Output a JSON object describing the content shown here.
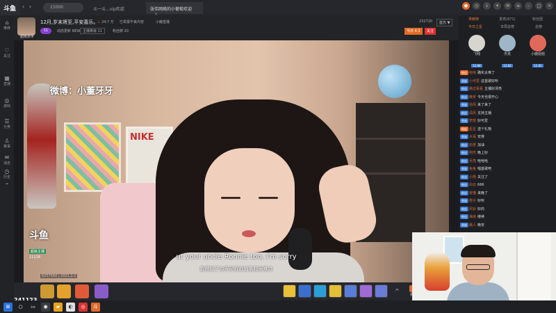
{
  "app": {
    "logo": "斗鱼"
  },
  "search": {
    "value": "15000"
  },
  "tabs": [
    {
      "label": "斗一斗...vip欢迎",
      "active": false
    },
    {
      "label": "张伟网络的小葡萄欢迎",
      "active": true
    }
  ],
  "sidebar": [
    {
      "icon": "⌂",
      "label": "推荐"
    },
    {
      "icon": "♡",
      "label": "关注"
    },
    {
      "icon": "▦",
      "label": "直播"
    },
    {
      "icon": "◎",
      "label": "游戏"
    },
    {
      "icon": "☰",
      "label": "分类"
    },
    {
      "icon": "♙",
      "label": "赛事"
    },
    {
      "icon": "✉",
      "label": "消息"
    },
    {
      "icon": "◷",
      "label": "历史"
    },
    {
      "icon": "⌄",
      "label": ""
    }
  ],
  "header": {
    "anchor_label": "超级杀手",
    "title": "12月,岁末将至,平安喜乐。",
    "popularity": "24.7 万",
    "report": "已举报不良内容",
    "category": "小鹿直播",
    "level": "11",
    "sub1": "动态更新 NEW",
    "rank_box": "主播等级 11",
    "sub2": "粉丝牌 20",
    "room_id": "232720",
    "follow_label": "今日 4.3",
    "follow2_label": "关注",
    "select": "蓝光 ▼"
  },
  "video": {
    "watermark": "微博：小董牙牙",
    "subtitle_en": "ut your uncle Ronnie too, I'm sorry",
    "subtitle_zh": "我得知了你罗尼叔叔的事我很难过",
    "douyu_logo": "斗鱼",
    "douyu_badge": "超级主播",
    "douyu_id": "11118"
  },
  "bottom": {
    "fans_label": "6257560 | 2021.2.1",
    "viewers": "241123",
    "more": "^",
    "recharge": "充值"
  },
  "right_panel": {
    "tabs": [
      {
        "label": "贡献榜",
        "active": true
      },
      {
        "label": "贵宾(671)",
        "active": false
      },
      {
        "label": "粉丝团",
        "active": false
      }
    ],
    "subtabs": [
      {
        "label": "今日之星",
        "active": true
      },
      {
        "label": "本周总榜",
        "active": false
      },
      {
        "label": "总榜",
        "active": false
      }
    ],
    "top_rank": [
      {
        "name": "飞翔",
        "level": "12.88"
      },
      {
        "name": "杰克",
        "level": "12.82"
      },
      {
        "name": "小鹿姐姐",
        "level": "12.81"
      }
    ],
    "chat": [
      {
        "badge": "粉丝",
        "badge_color": "#e66b2a",
        "name": "哈哈",
        "text": "确实太难了"
      },
      {
        "badge": "贵族",
        "badge_color": "#3b7bd4",
        "name": "小可爱",
        "text": "这首歌好听"
      },
      {
        "badge": "粉丝",
        "badge_color": "#3b7bd4",
        "name": "路过看看",
        "text": "主播好漂亮"
      },
      {
        "badge": "粉丝",
        "badge_color": "#3b7bd4",
        "name": "晚安",
        "text": "今天也很开心"
      },
      {
        "badge": "贵族",
        "badge_color": "#3b7bd4",
        "name": "追风",
        "text": "来了来了"
      },
      {
        "badge": "粉丝",
        "badge_color": "#3b7bd4",
        "name": "清风",
        "text": "支持主播"
      },
      {
        "badge": "贵族",
        "badge_color": "#3b7bd4",
        "name": "梦想",
        "text": "好可爱"
      },
      {
        "badge": "粉丝",
        "badge_color": "#e66b2a",
        "name": "星星",
        "text": "送个礼物"
      },
      {
        "badge": "贵族",
        "badge_color": "#3b7bd4",
        "name": "大哥",
        "text": "安排"
      },
      {
        "badge": "粉丝",
        "badge_color": "#3b7bd4",
        "name": "奶茶",
        "text": "加油"
      },
      {
        "badge": "粉丝",
        "badge_color": "#3b7bd4",
        "name": "阿杰",
        "text": "晚上好"
      },
      {
        "badge": "粉丝",
        "badge_color": "#3b7bd4",
        "name": "月亮",
        "text": "哈哈哈"
      },
      {
        "badge": "贵族",
        "badge_color": "#3b7bd4",
        "name": "兔兔",
        "text": "唱首歌吧"
      },
      {
        "badge": "粉丝",
        "badge_color": "#3b7bd4",
        "name": "小熊",
        "text": "关注了"
      },
      {
        "badge": "粉丝",
        "badge_color": "#3b7bd4",
        "name": "白云",
        "text": "666"
      },
      {
        "badge": "粉丝",
        "badge_color": "#3b7bd4",
        "name": "夜猫",
        "text": "来晚了"
      },
      {
        "badge": "贵族",
        "badge_color": "#3b7bd4",
        "name": "橙子",
        "text": "好听"
      },
      {
        "badge": "粉丝",
        "badge_color": "#3b7bd4",
        "name": "风铃",
        "text": "好的"
      },
      {
        "badge": "粉丝",
        "badge_color": "#3b7bd4",
        "name": "海浪",
        "text": "继续"
      },
      {
        "badge": "贵族",
        "badge_color": "#3b7bd4",
        "name": "路人",
        "text": "晚安"
      }
    ]
  },
  "colors": {
    "accent": "#e06a2b",
    "panel": "#1e1f23",
    "topbar": "#26272c"
  }
}
